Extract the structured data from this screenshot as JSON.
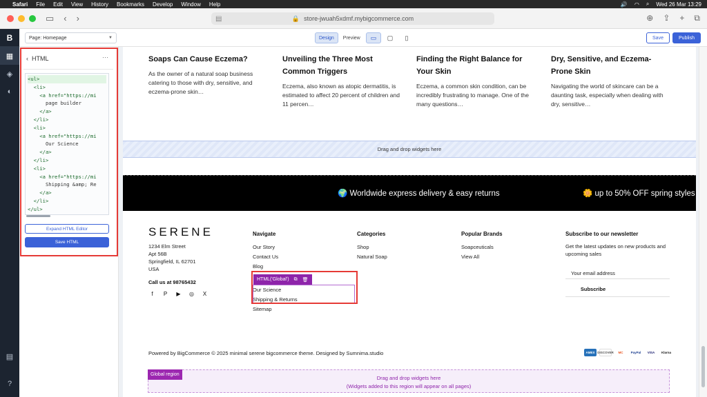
{
  "menubar": {
    "app": "Safari",
    "items": [
      "File",
      "Edit",
      "View",
      "History",
      "Bookmarks",
      "Develop",
      "Window",
      "Help"
    ],
    "datetime": "Wed 26 Mar  13:29"
  },
  "browser": {
    "url": "store-jwuah5xdmf.mybigcommerce.com"
  },
  "builder": {
    "page_select": "Page: Homepage",
    "design_label": "Design",
    "preview_label": "Preview",
    "save_label": "Save",
    "publish_label": "Publish"
  },
  "panel": {
    "title": "HTML",
    "code_lines": [
      "<ul>",
      "  <li>",
      "    <a href=\"https://mi",
      "      page builder",
      "    </a>",
      "  </li>",
      "  <li>",
      "    <a href=\"https://mi",
      "      Our Science",
      "    </a>",
      "  </li>",
      "  <li>",
      "    <a href=\"https://mi",
      "      Shipping &amp; Re",
      "    </a>",
      "  </li>",
      "</ul>"
    ],
    "expand_label": "Expand HTML Editor",
    "save_label": "Save HTML"
  },
  "blog_posts": [
    {
      "title": "Soaps Can Cause Eczema?",
      "desc": "As the owner of a natural soap business catering to those with dry, sensitive, and eczema-prone skin…"
    },
    {
      "title": "Unveiling the Three Most Common Triggers",
      "desc": "Eczema, also known as atopic dermatitis, is estimated to affect 20 percent of children and 11 percen…"
    },
    {
      "title": "Finding the Right Balance for Your Skin",
      "desc": "Eczema, a common skin condition, can be incredibly frustrating to manage. One of the many questions…"
    },
    {
      "title": "Dry, Sensitive, and Eczema-Prone Skin",
      "desc": "Navigating the world of skincare can be a daunting task, especially when dealing with dry, sensitive…"
    }
  ],
  "dropzone_label": "Drag and drop widgets here",
  "ticker": {
    "item1": "🌍 Worldwide express delivery & easy returns",
    "item2": "🌼 up to 50% OFF spring styles"
  },
  "footer": {
    "brand": "SERENE",
    "address": [
      "1234 Elm Street",
      "Apt 56B",
      "Springfield, IL 62701",
      "USA"
    ],
    "call": "Call us at 98765432",
    "navigate": {
      "heading": "Navigate",
      "links_top": [
        "Our Story",
        "Contact Us",
        "Blog"
      ],
      "links_widget": [
        "Our Science",
        "Shipping & Returns"
      ],
      "links_bottom": [
        "Sitemap"
      ]
    },
    "categories": {
      "heading": "Categories",
      "links": [
        "Shop",
        "Natural Soap"
      ]
    },
    "brands": {
      "heading": "Popular Brands",
      "links": [
        "Soapceuticals",
        "View All"
      ]
    },
    "newsletter": {
      "heading": "Subscribe to our newsletter",
      "desc": "Get the latest updates on new products and upcoming sales",
      "input_placeholder": "Your email address",
      "button": "Subscribe"
    },
    "widget_tag": "HTML('Global')",
    "powered": "Powered by BigCommerce © 2025 minimal serene bigcommerce theme. Designed by Sumnima.studio",
    "payments": [
      "AMEX",
      "DISCOVER",
      "MC",
      "PayPal",
      "VISA",
      "Klarna"
    ]
  },
  "global_region": {
    "tag": "Global region",
    "line1": "Drag and drop widgets here",
    "line2": "(Widgets added to this region will appear on all pages)"
  },
  "colors": {
    "accent": "#3b62d8",
    "highlight": "#e53935",
    "widget": "#8e24aa"
  }
}
